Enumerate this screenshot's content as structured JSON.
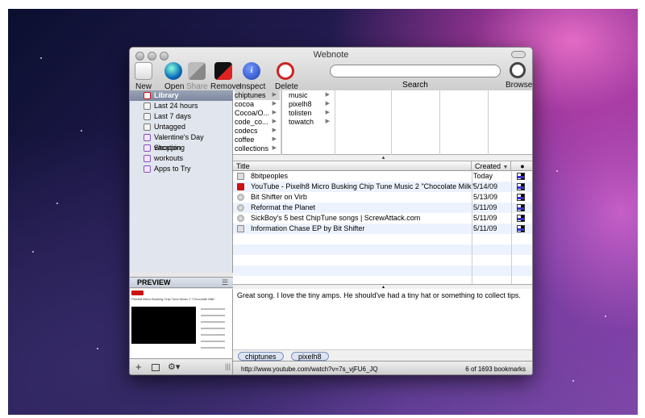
{
  "window": {
    "title": "Webnote"
  },
  "toolbar": {
    "new_label": "New",
    "open_label": "Open",
    "share_label": "Share",
    "remove_label": "Remove",
    "inspect_label": "Inspect",
    "delete_label": "Delete",
    "search_label": "Search",
    "search_value": "",
    "browse_label": "Browse"
  },
  "sidebar": {
    "items": [
      {
        "label": "Library"
      },
      {
        "label": "Last 24 hours"
      },
      {
        "label": "Last 7 days"
      },
      {
        "label": "Untagged"
      },
      {
        "label": "Valentine's Day Shopping"
      },
      {
        "label": "vacation"
      },
      {
        "label": "workouts"
      },
      {
        "label": "Apps to Try"
      }
    ]
  },
  "preview": {
    "header": "PREVIEW",
    "menu_icon": "list-icon",
    "video_title": "Pixelh8 Micro Busking Chip Tune Music 2 \"Chocolate Milk\""
  },
  "bottom_bar": {
    "add": "+",
    "action": "gear-icon",
    "resize": "|||"
  },
  "browser": {
    "col1": [
      "chiptunes",
      "cocoa",
      "Cocoa/O...",
      "code_co...",
      "codecs",
      "coffee",
      "collections"
    ],
    "col2": [
      "music",
      "pixelh8",
      "tolisten",
      "towatch"
    ]
  },
  "table": {
    "headers": {
      "title": "Title",
      "created": "Created",
      "flag": "●"
    },
    "rows": [
      {
        "title": "8bitpeoples",
        "date": "Today",
        "icon": "page"
      },
      {
        "title": "YouTube - Pixelh8 Micro Busking Chip Tune Music 2 \"Chocolate Milk\"",
        "date": "5/14/09",
        "icon": "yt"
      },
      {
        "title": "Bit Shifter on Virb",
        "date": "5/13/09",
        "icon": "globe"
      },
      {
        "title": "Reformat the Planet",
        "date": "5/11/09",
        "icon": "globe"
      },
      {
        "title": "SickBoy's 5 best ChipTune songs | ScrewAttack.com",
        "date": "5/11/09",
        "icon": "globe"
      },
      {
        "title": "Information Chase EP by Bit Shifter",
        "date": "5/11/09",
        "icon": "page"
      }
    ]
  },
  "notes": {
    "text": "Great song.  I love the tiny amps.  He should've had a tiny hat or something to collect tips."
  },
  "tags": [
    "chiptunes",
    "pixelh8"
  ],
  "status": {
    "url": "http://www.youtube.com/watch?v=7s_vjFU6_JQ",
    "count": "6 of 1693 bookmarks"
  },
  "colors": {
    "selection": "#7c86a0",
    "accent": "#3366cc",
    "delete": "#cc2222"
  }
}
